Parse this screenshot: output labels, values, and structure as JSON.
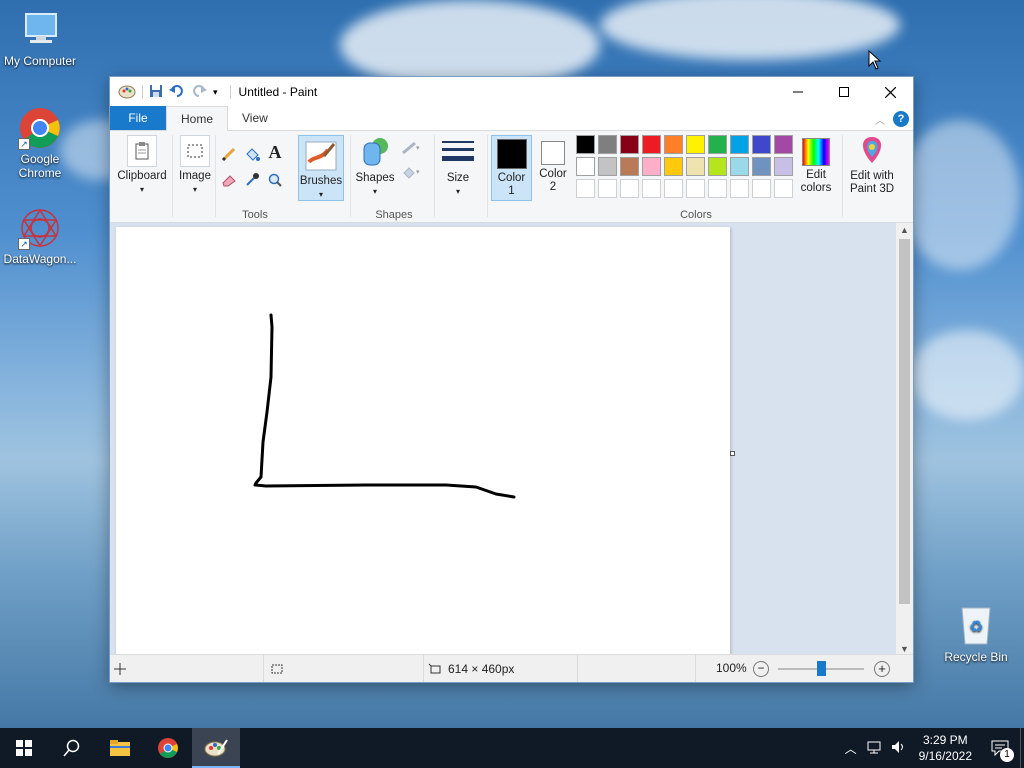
{
  "desktop": {
    "icons": [
      {
        "label": "My Computer"
      },
      {
        "label": "Google Chrome"
      },
      {
        "label": "DataWagon..."
      },
      {
        "label": "Recycle Bin"
      }
    ]
  },
  "window": {
    "title": "Untitled - Paint",
    "tabs": {
      "file": "File",
      "home": "Home",
      "view": "View"
    },
    "help_label": "?"
  },
  "ribbon": {
    "clipboard": "Clipboard",
    "image": "Image",
    "tools_group": "Tools",
    "text_tool": "A",
    "brushes": "Brushes",
    "shapes": "Shapes",
    "shapes_group": "Shapes",
    "size": "Size",
    "color1_line1": "Color",
    "color1_line2": "1",
    "color2_line1": "Color",
    "color2_line2": "2",
    "colors_group": "Colors",
    "edit_colors_line1": "Edit",
    "edit_colors_line2": "colors",
    "paint3d_line1": "Edit with",
    "paint3d_line2": "Paint 3D",
    "palette_row1": [
      "#000000",
      "#7f7f7f",
      "#880015",
      "#ed1c24",
      "#ff7f27",
      "#fff200",
      "#22b14c",
      "#00a2e8",
      "#3f48cc",
      "#a349a4"
    ],
    "palette_row2": [
      "#ffffff",
      "#c3c3c3",
      "#b97a57",
      "#ffaec9",
      "#ffc90e",
      "#efe4b0",
      "#b5e61d",
      "#99d9ea",
      "#7092be",
      "#c8bfe7"
    ],
    "color1_value": "#000000",
    "color2_value": "#ffffff"
  },
  "status": {
    "dimensions": "614 × 460px",
    "zoom": "100%",
    "zoom_level": 0.5
  },
  "taskbar": {
    "time": "3:29 PM",
    "date": "9/16/2022",
    "notifications": "1"
  }
}
